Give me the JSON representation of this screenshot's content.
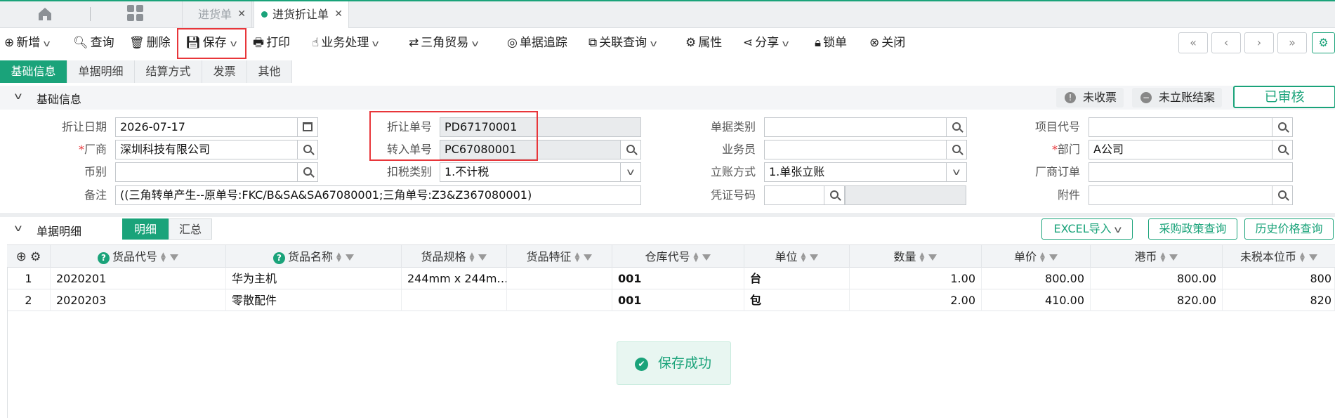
{
  "tabs": [
    {
      "label": "进货单"
    },
    {
      "label": "进货折让单"
    }
  ],
  "toolbar": {
    "new": "新增",
    "query": "查询",
    "delete": "删除",
    "save": "保存",
    "print": "打印",
    "business": "业务处理",
    "triangle": "三角贸易",
    "trace": "单据追踪",
    "related": "关联查询",
    "attr": "属性",
    "share": "分享",
    "lock": "锁单",
    "close": "关闭"
  },
  "section_tabs": [
    "基础信息",
    "单据明细",
    "结算方式",
    "发票",
    "其他"
  ],
  "basic": {
    "title": "基础信息",
    "badge_invoice": "未收票",
    "badge_account": "未立账结案",
    "audit": "已审核"
  },
  "form": {
    "date_label": "折让日期",
    "date_value": "2026-07-17",
    "vendor_label": "厂商",
    "vendor_value": "深圳科技有限公司",
    "currency_label": "币别",
    "currency_value": "",
    "remark_label": "备注",
    "remark_value": "((三角转单产生--原单号:FKC/B&SA&SA67080001;三角单号:Z3&Z367080001)",
    "discount_no_label": "折让单号",
    "discount_no_value": "PD67170001",
    "transfer_no_label": "转入单号",
    "transfer_no_value": "PC67080001",
    "tax_label": "扣税类别",
    "tax_value": "1.不计税",
    "doc_type_label": "单据类别",
    "doc_type_value": "",
    "staff_label": "业务员",
    "staff_value": "",
    "account_label": "立账方式",
    "account_value": "1.单张立账",
    "voucher_label": "凭证号码",
    "voucher_value": "",
    "project_label": "项目代号",
    "project_value": "",
    "dept_label": "部门",
    "dept_value": "A公司",
    "vendor_order_label": "厂商订单",
    "vendor_order_value": "",
    "attach_label": "附件",
    "attach_value": ""
  },
  "detail": {
    "title": "单据明细",
    "tab_detail": "明细",
    "tab_summary": "汇总",
    "excel_btn": "EXCEL导入",
    "policy_btn": "采购政策查询",
    "history_btn": "历史价格查询",
    "columns": [
      "货品代号",
      "货品名称",
      "货品规格",
      "货品特征",
      "仓库代号",
      "单位",
      "数量",
      "单价",
      "港币",
      "未税本位币"
    ],
    "rows": [
      {
        "idx": "1",
        "code": "2020201",
        "name": "华为主机",
        "spec": "244mm x 244m…",
        "feature": "",
        "wh": "001",
        "unit": "台",
        "qty": "1.00",
        "price": "800.00",
        "hkd": "800.00",
        "base": "800"
      },
      {
        "idx": "2",
        "code": "2020203",
        "name": "零散配件",
        "spec": "",
        "feature": "",
        "wh": "001",
        "unit": "包",
        "qty": "2.00",
        "price": "410.00",
        "hkd": "820.00",
        "base": "820"
      }
    ]
  },
  "toast": "保存成功",
  "colors": {
    "accent": "#1aa37a",
    "highlight": "#e8363a"
  }
}
